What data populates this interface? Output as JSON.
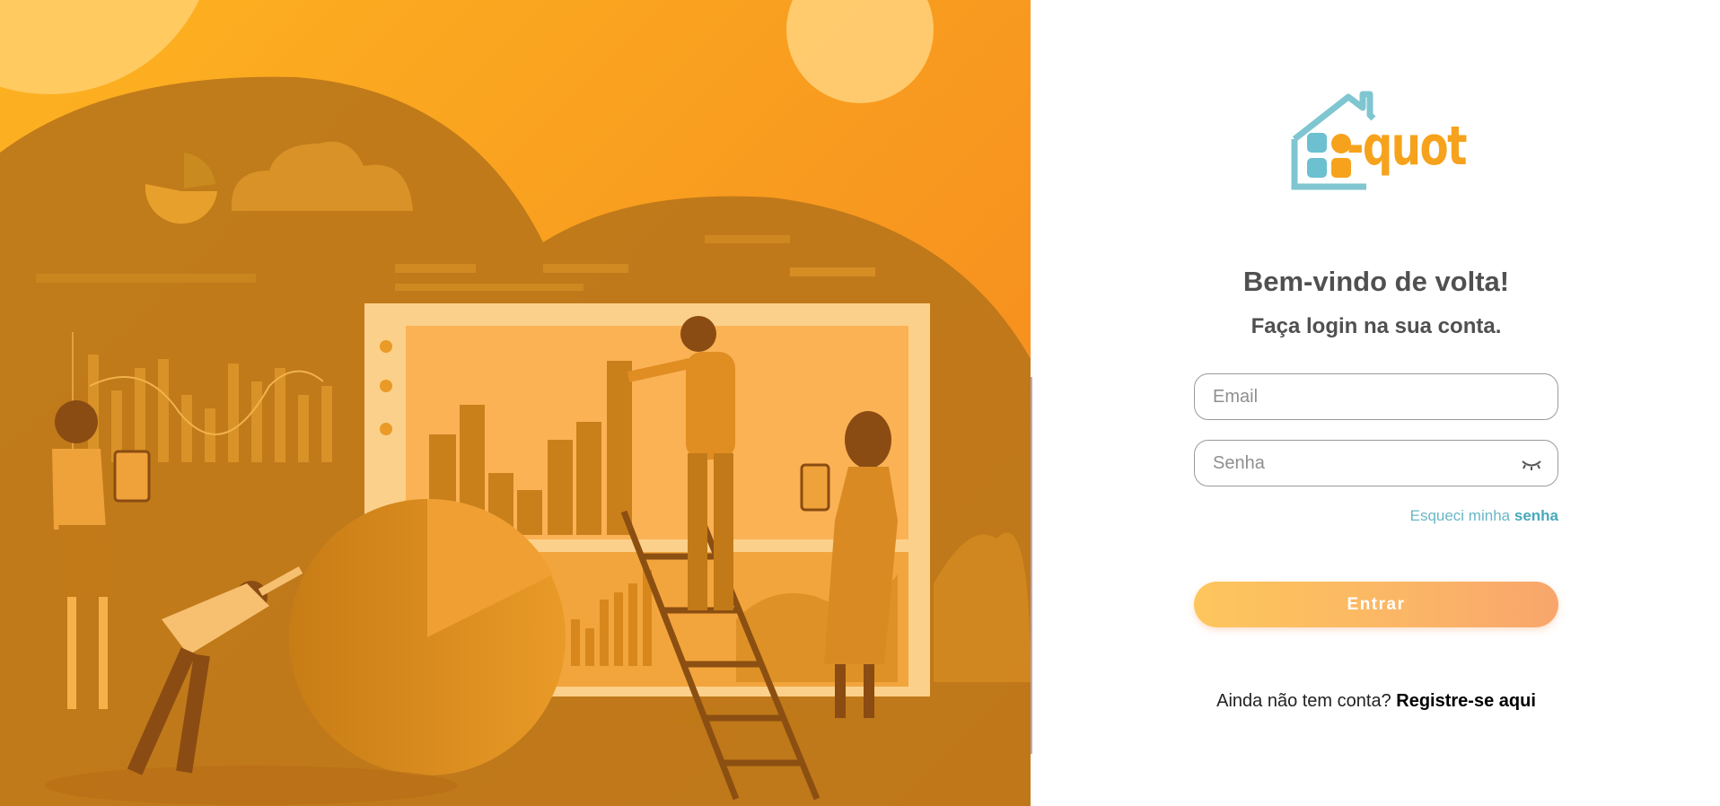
{
  "colors": {
    "hero_orange": "#f89a1f",
    "brand_orange": "#f6a21c",
    "brand_teal": "#6ab7c6",
    "button_start": "#fdc65c",
    "button_end": "#f8a66c",
    "heading_text": "#505050"
  },
  "logo": {
    "wordmark": "-quot",
    "icon": "house-icon"
  },
  "login": {
    "title": "Bem-vindo de volta!",
    "subtitle": "Faça login na sua conta.",
    "email": {
      "placeholder": "Email",
      "value": ""
    },
    "password": {
      "placeholder": "Senha",
      "value": "",
      "toggle_icon": "eye-closed-icon"
    },
    "forgot": {
      "text": "Esqueci minha",
      "emphasis": "senha"
    },
    "submit_label": "Entrar",
    "signup": {
      "prompt": "Ainda não tem conta?",
      "link": "Registre-se aqui"
    }
  }
}
